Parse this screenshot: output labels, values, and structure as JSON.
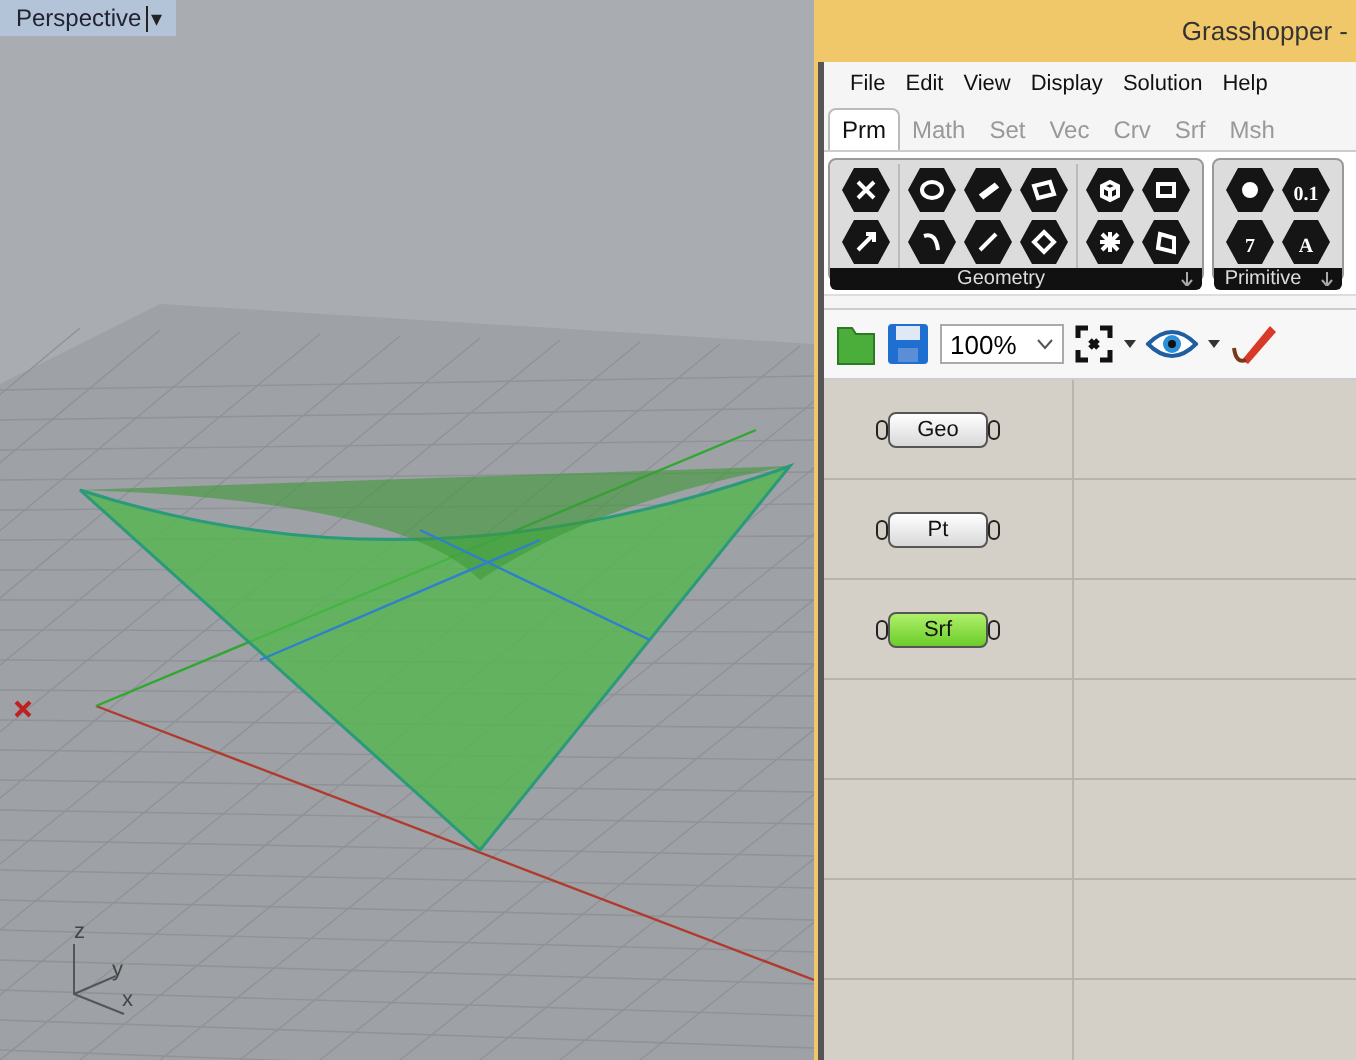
{
  "viewport": {
    "title": "Perspective",
    "dropdown": "▾",
    "axis_labels": [
      "z",
      "y",
      "x"
    ]
  },
  "window": {
    "title": "Grasshopper -"
  },
  "menu": [
    "File",
    "Edit",
    "View",
    "Display",
    "Solution",
    "Help"
  ],
  "tabs": [
    {
      "label": "Prm",
      "selected": true
    },
    {
      "label": "Math",
      "selected": false
    },
    {
      "label": "Set",
      "selected": false
    },
    {
      "label": "Vec",
      "selected": false
    },
    {
      "label": "Crv",
      "selected": false
    },
    {
      "label": "Srf",
      "selected": false
    },
    {
      "label": "Msh",
      "selected": false
    }
  ],
  "panels": [
    {
      "title": "Geometry"
    },
    {
      "title": "Primitive",
      "icon_labels": [
        "0.1",
        "7",
        "A"
      ]
    }
  ],
  "toolbar": {
    "zoom": "100%"
  },
  "nodes": [
    {
      "label": "Geo",
      "selected": false
    },
    {
      "label": "Pt",
      "selected": false
    },
    {
      "label": "Srf",
      "selected": true
    }
  ]
}
